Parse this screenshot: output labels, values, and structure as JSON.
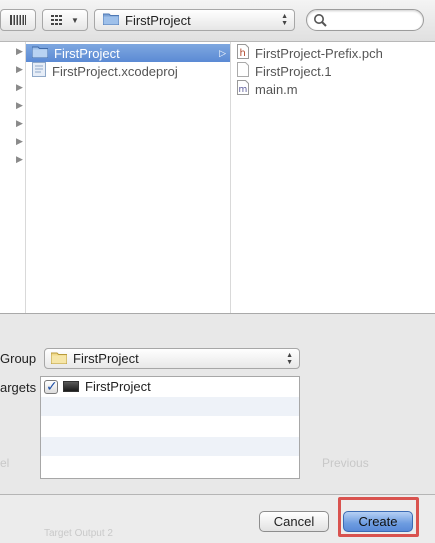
{
  "toolbar": {
    "path_label": "FirstProject",
    "search_placeholder": ""
  },
  "browser": {
    "column2": [
      {
        "label": "FirstProject",
        "icon": "folder-icon",
        "selected": true
      },
      {
        "label": "FirstProject.xcodeproj",
        "icon": "xcodeproj-icon",
        "selected": false
      }
    ],
    "column3": [
      {
        "label": "FirstProject-Prefix.pch",
        "icon": "header-file-icon"
      },
      {
        "label": "FirstProject.1",
        "icon": "document-icon"
      },
      {
        "label": "main.m",
        "icon": "objc-file-icon"
      }
    ]
  },
  "options": {
    "group_label": "Group",
    "group_value": "FirstProject",
    "targets_label": "argets",
    "targets": [
      {
        "label": "FirstProject",
        "checked": true
      }
    ],
    "ghost_left": "el",
    "ghost_previous": "Previous"
  },
  "buttons": {
    "cancel": "Cancel",
    "create": "Create"
  },
  "bottom_ghost": "Target Output 2",
  "colors": {
    "selection": "#5b8ad4",
    "default_button": "#6d9ce0",
    "highlight": "#d9534f"
  }
}
